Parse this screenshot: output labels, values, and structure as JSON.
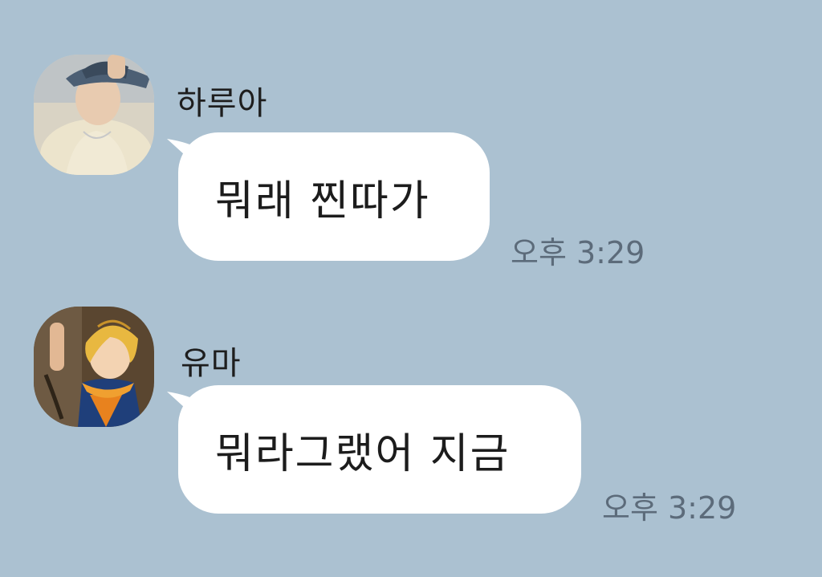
{
  "background_color": "#abc1d1",
  "messages": [
    {
      "sender": "하루아",
      "text": "뭐래 찐따가",
      "time": "오후 3:29",
      "avatar_icon": "profile-photo-person-cap"
    },
    {
      "sender": "유마",
      "text": "뭐라그랬어 지금",
      "time": "오후 3:29",
      "avatar_icon": "profile-photo-anime-character"
    }
  ]
}
